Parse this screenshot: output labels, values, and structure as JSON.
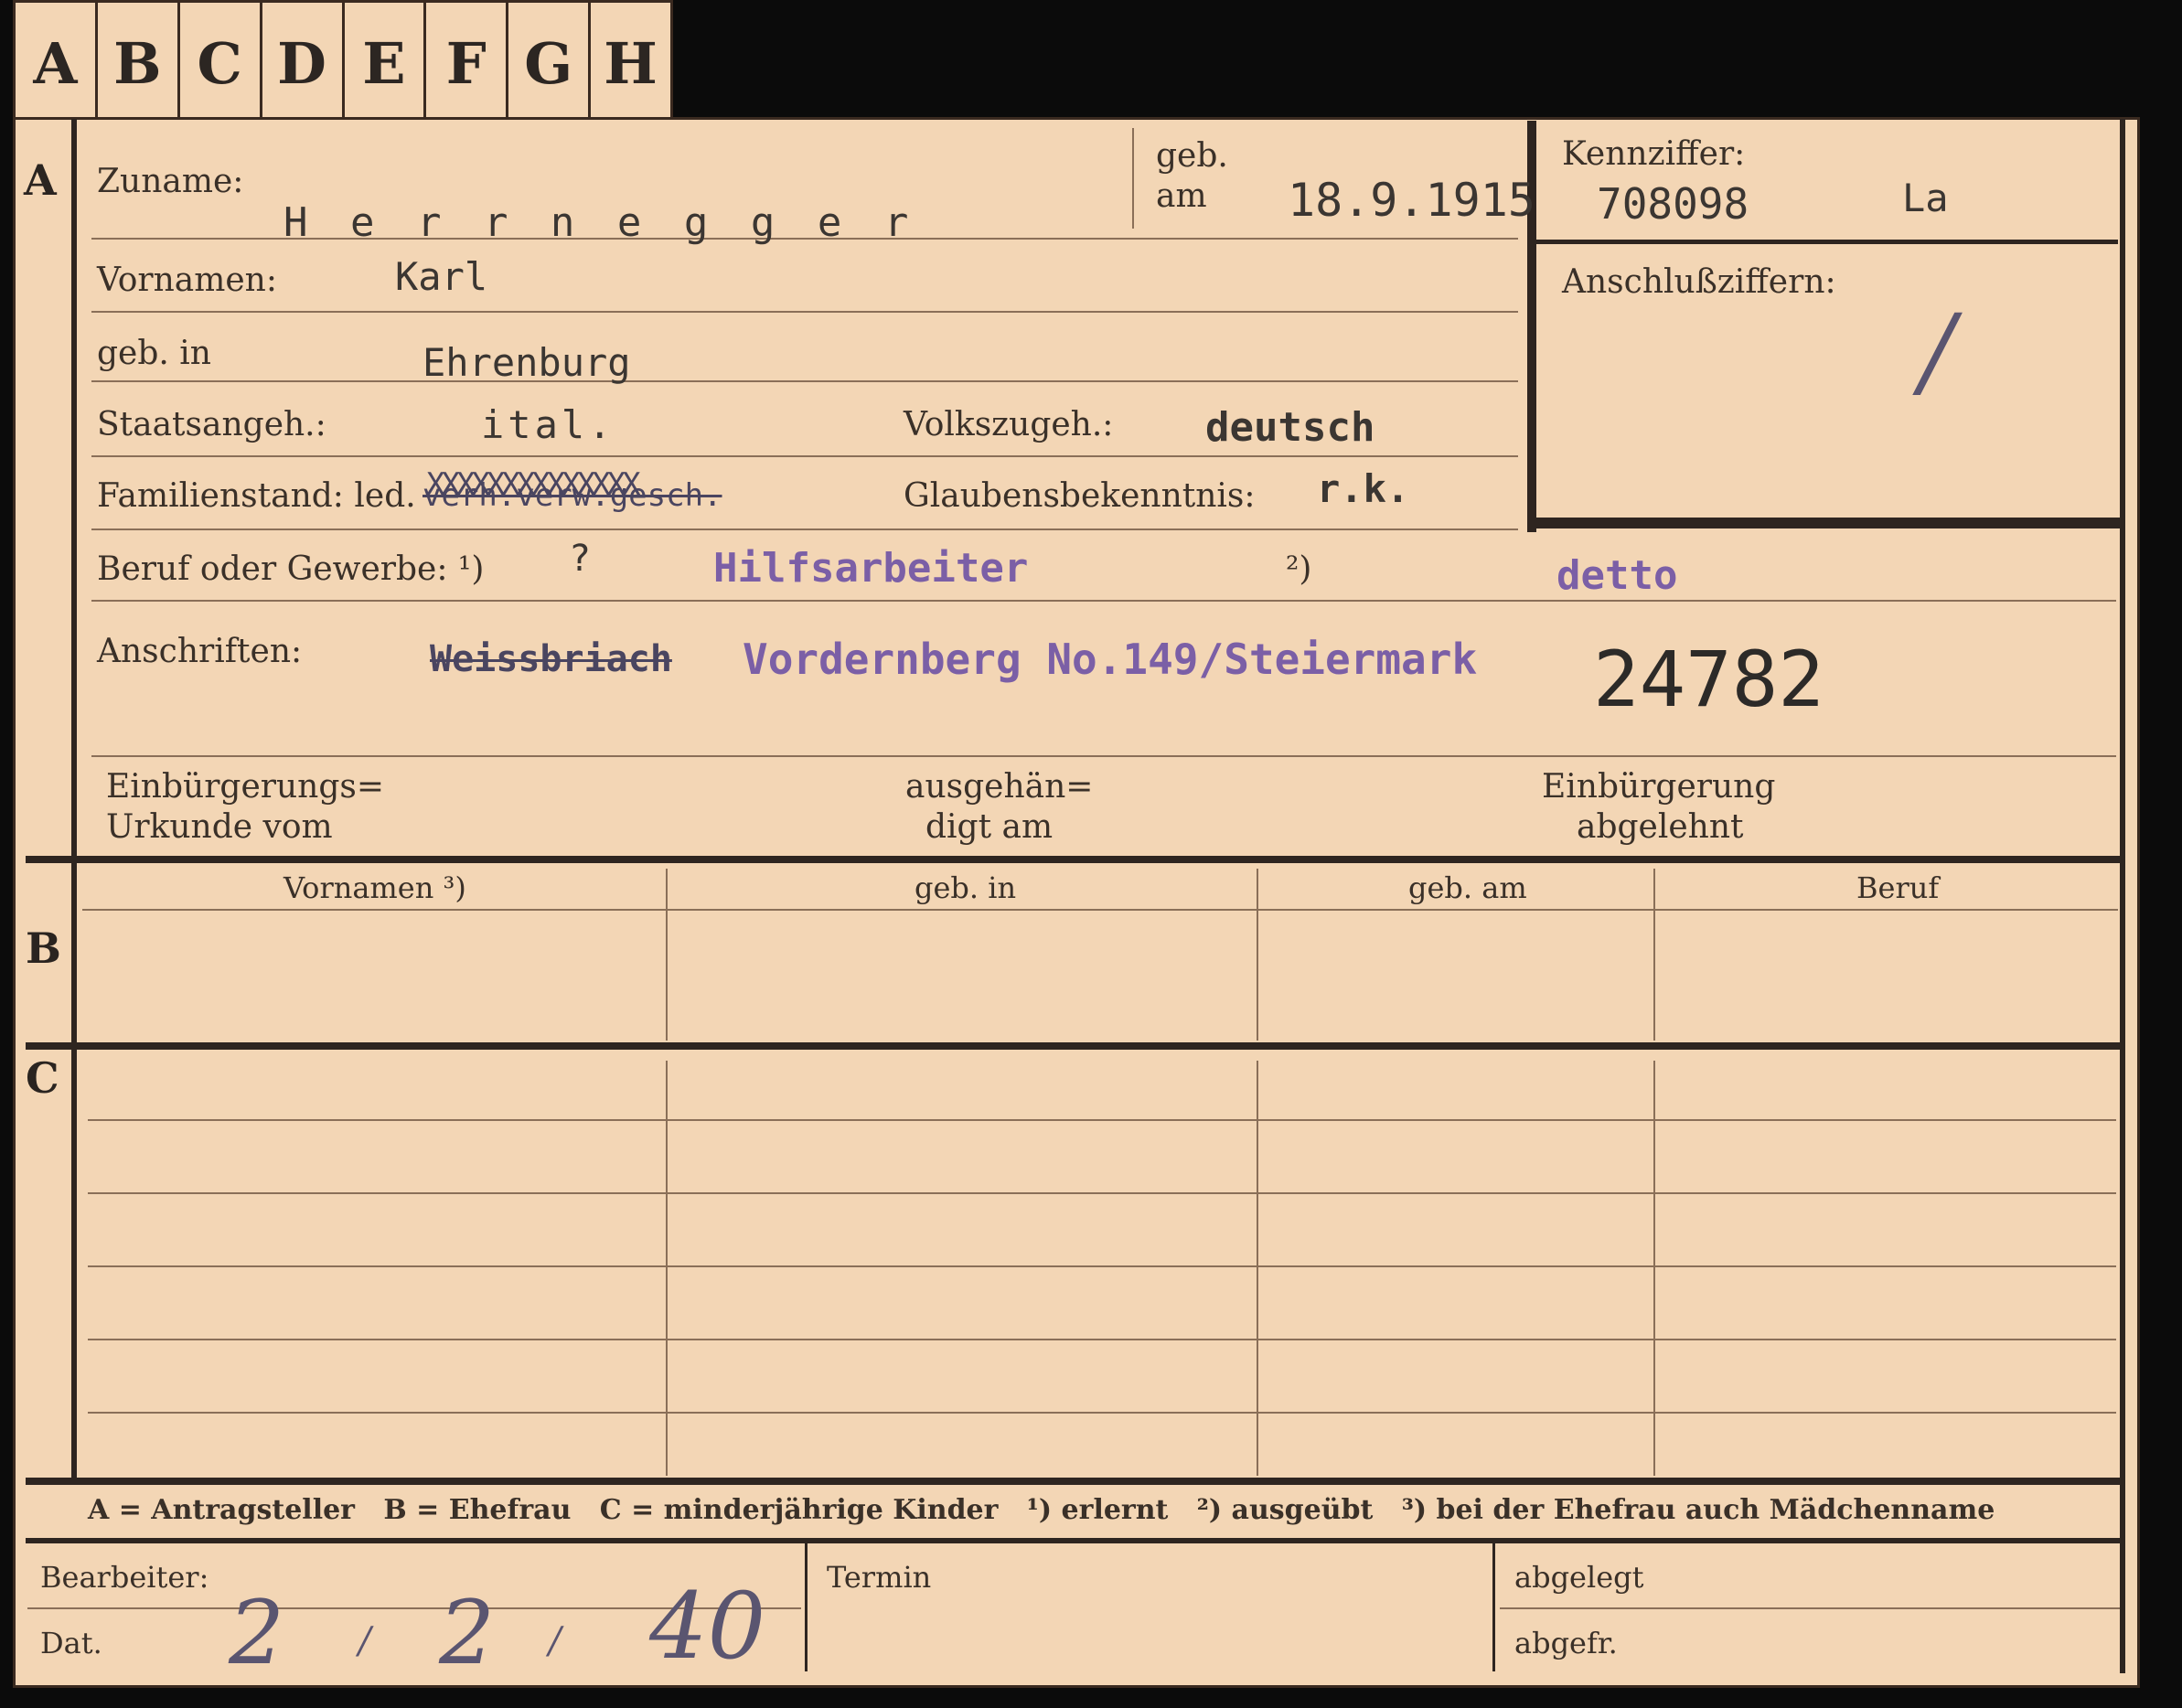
{
  "tabs": [
    "A",
    "B",
    "C",
    "D",
    "E",
    "F",
    "G",
    "H"
  ],
  "section_letters": {
    "a": "A",
    "b": "B",
    "c": "C"
  },
  "labels": {
    "zuname": "Zuname:",
    "geb_am": "geb.\nam",
    "geb_am_1": "geb.",
    "geb_am_2": "am",
    "kennziffer": "Kennziffer:",
    "vornamen": "Vornamen:",
    "anschlussziffern": "Anschlußziffern:",
    "geb_in": "geb. in",
    "staatsangeh": "Staatsangeh.:",
    "volkszugeh": "Volkszugeh.:",
    "familienstand": "Familienstand: led.",
    "glaubensbekenntnis": "Glaubensbekenntnis:",
    "beruf": "Beruf oder Gewerbe: ¹)",
    "note2": "²)",
    "anschriften": "Anschriften:",
    "einbuergerungs_1": "Einbürgerungs=",
    "einbuergerungs_2": "Urkunde vom",
    "ausgehaen_1": "ausgehän=",
    "ausgehaen_2": "digt am",
    "einbuergerung_1": "Einbürgerung",
    "einbuergerung_2": "abgelehnt",
    "bearbeiter": "Bearbeiter:",
    "dat": "Dat.",
    "termin": "Termin",
    "abgelegt": "abgelegt",
    "abgefr": "abgefr."
  },
  "table_b_headers": [
    "Vornamen ³)",
    "geb. in",
    "geb. am",
    "Beruf"
  ],
  "legend": "A = Antragsteller   B = Ehefrau   C = minderjährige Kinder   ¹) erlernt   ²) ausgeübt   ³) bei der Ehefrau auch Mädchenname",
  "values": {
    "zuname": "H e r r n e g g e r",
    "geb_am": "18.9.1915",
    "kennziffer": "708098",
    "kennziffer_suffix": "La",
    "vornamen": "Karl",
    "geb_in": "Ehrenburg",
    "staatsangeh": "ital.",
    "volkszugeh": "deutsch",
    "familienstand_struck": "verh.verw.gesch.",
    "familienstand_x": "XXXXXXXXXXXXXX",
    "glaube": "r.k.",
    "beruf_q": "?",
    "beruf_erlernt": "Hilfsarbeiter",
    "beruf_ausgeuebt": "detto",
    "anschrift_struck": "Weissbriach",
    "anschrift": "Vordernberg No.149/Steiermark",
    "number": "24782",
    "dat_day": "2",
    "dat_month": "2",
    "dat_year": "40",
    "slash": "/",
    "anschluss_mark": "/"
  }
}
